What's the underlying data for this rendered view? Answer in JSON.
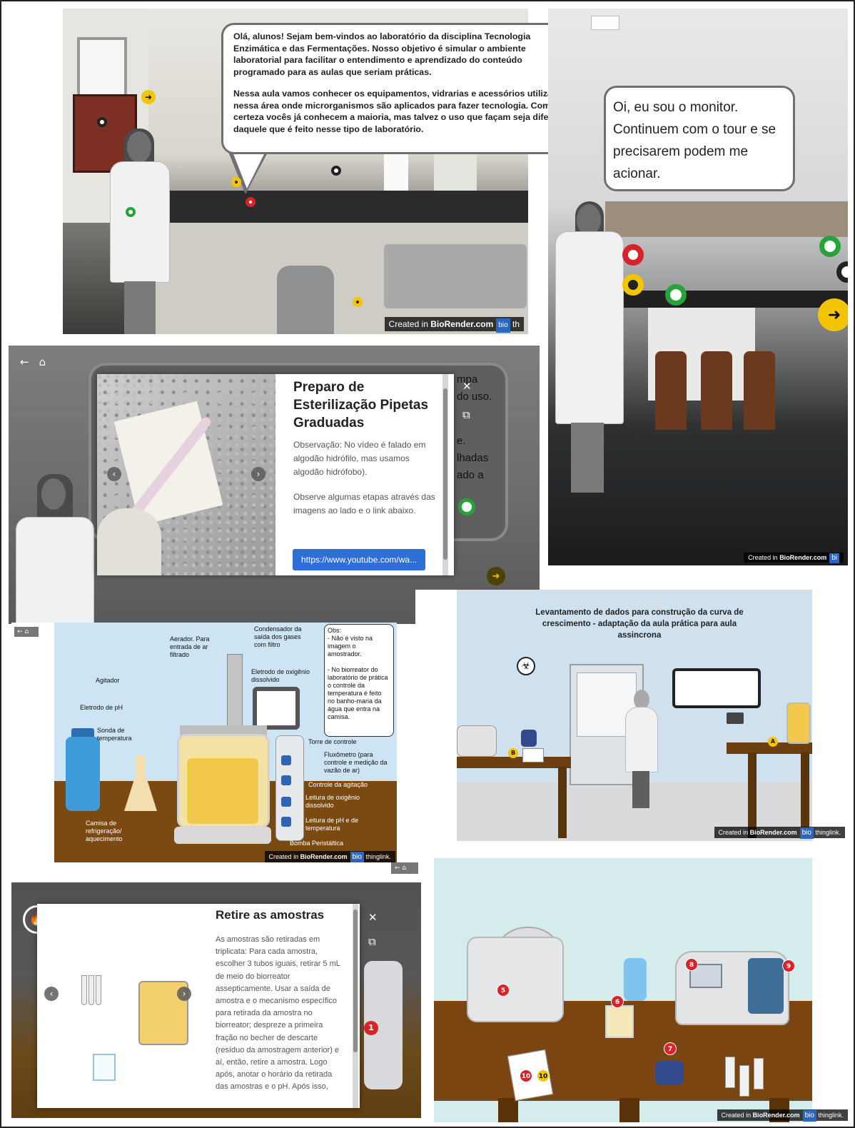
{
  "panel_welcome": {
    "speech_p1": "Olá, alunos! Sejam bem-vindos ao laboratório da disciplina Tecnologia Enzimática e das Fermentações. Nosso objetivo é simular o ambiente laboratorial para facilitar o entendimento e aprendizado do conteúdo programado para as aulas que seriam práticas.",
    "speech_p2": "Nessa aula vamos conhecer os equipamentos, vidrarias e acessórios utilizados nessa área onde microrganismos são aplicados para fazer tecnologia. Com certeza vocês já conhecem a maioria, mas talvez o uso que façam seja diferente daquele que é feito nesse tipo de laboratório.",
    "credit_prefix": "Created in ",
    "credit_brand": "BioRender.com",
    "credit_badge": "bio",
    "credit_suffix": "th",
    "arrow_glyph": "➜"
  },
  "panel_monitor": {
    "speech": "Oi, eu sou o monitor. Continuem com o tour e se precisarem podem me acionar.",
    "credit_prefix": "Created in ",
    "credit_brand": "BioRender.com",
    "credit_badge": "bi",
    "arrow_glyph": "➜"
  },
  "panel_pipetas": {
    "back_glyph": "←",
    "home_glyph": "⌂",
    "title": "Preparo de Esterilização Pipetas Graduadas",
    "body_p1": "Observação: No vídeo é falado em algodão hidrófilo, mas usamos algodão hidrófobo).",
    "body_p2": "Observe algumas etapas através das imagens ao lado e o link abaixo.",
    "link_label": "https://www.youtube.com/wa...",
    "close_glyph": "✕",
    "reader_glyph": "⧉",
    "prev_glyph": "‹",
    "next_glyph": "›",
    "bg_text_1": "mpa",
    "bg_text_2": "do uso.",
    "bg_text_3": "e.",
    "bg_text_4": "lhadas",
    "bg_text_5": "ado a",
    "arrow_glyph": "➜"
  },
  "panel_bioreactor": {
    "nav": "← ⌂",
    "labels": {
      "aerador": "Aerador. Para entrada de ar filtrado",
      "condensador": "Condensador da saída dos gases com filtro",
      "eletrodo_o2": "Eletrodo de oxigênio dissolvido",
      "agitador": "Agitador",
      "eletrodo_ph": "Eletrodo de pH",
      "sonda": "Sonda de temperatura",
      "torre": "Torre de controle",
      "fluxometro": "Fluxômetro (para controle e medição da vazão de ar)",
      "controle_agitacao": "Controle da agitação",
      "leitura_o2": "Leitura de oxigênio dissolvido",
      "leitura_ph": "Leitura de pH  e de temperatura",
      "bomba": "Bomba Peristáltica",
      "camisa": "Camisa de refrigeração/ aquecimento"
    },
    "obs": "Obs:\n- Não é visto na imagem o amostrador.\n\n- No biorreator do laboratório de prática o controle da temperatura é feito no banho-maria da água que entra na camisa.",
    "credit_prefix": "Created in ",
    "credit_brand": "BioRender.com",
    "credit_badge": "bio",
    "credit_suffix": "thinglink."
  },
  "panel_growth": {
    "heading": "Levantamento de dados para construção da curva de crescimento - adaptação da aula prática para aula assincrona",
    "label_a": "A",
    "label_b": "B",
    "biohazard": "☣",
    "credit_prefix": "Created in ",
    "credit_brand": "BioRender.com",
    "credit_badge": "bio",
    "credit_suffix": "thinglink.",
    "nav": "← ⌂"
  },
  "panel_sampling": {
    "title": "Retire as amostras",
    "body": "As amostras são retiradas em triplicata: Para cada amostra, escolher 3 tubos iguais, retirar 5 mL de meio do biorreator assepticamente. Usar a saída de amostra e o mecanismo específico para retirada da amostra no biorreator; despreze a primeira fração no becher de descarte (resíduo da amostragem anterior) e aí, então, retire a amostra. Logo após, anotar o horário da retirada das amostras e o pH. Após isso,",
    "close_glyph": "✕",
    "reader_glyph": "⧉",
    "prev_glyph": "‹",
    "next_glyph": "›",
    "badge_1": "1",
    "hazard_glyph": "🔥"
  },
  "panel_equipment": {
    "badges": [
      "5",
      "6",
      "7",
      "8",
      "9",
      "10",
      "10"
    ],
    "credit_prefix": "Created in ",
    "credit_brand": "BioRender.com",
    "credit_badge": "bio",
    "credit_suffix": "thinglink."
  }
}
